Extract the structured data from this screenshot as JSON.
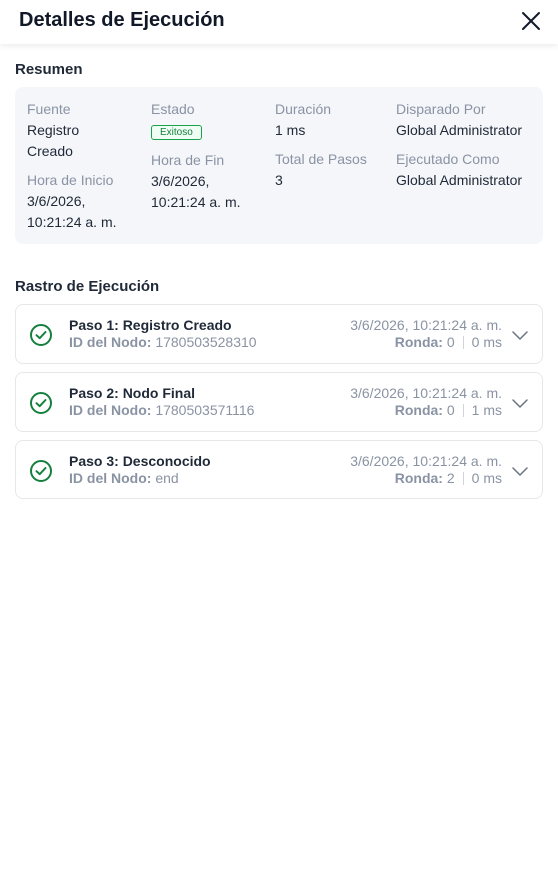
{
  "header": {
    "title": "Detalles de Ejecución"
  },
  "summary": {
    "title": "Resumen",
    "source_label": "Fuente",
    "source_value": "Registro Creado",
    "status_label": "Estado",
    "status_value": "Exitoso",
    "duration_label": "Duración",
    "duration_value": "1 ms",
    "triggered_by_label": "Disparado Por",
    "triggered_by_value": "Global Administrator",
    "start_label": "Hora de Inicio",
    "start_value": "3/6/2026, 10:21:24 a. m.",
    "end_label": "Hora de Fin",
    "end_value": "3/6/2026, 10:21:24 a. m.",
    "total_steps_label": "Total de Pasos",
    "total_steps_value": "3",
    "executed_as_label": "Ejecutado Como",
    "executed_as_value": "Global Administrator"
  },
  "trace": {
    "title": "Rastro de Ejecución",
    "node_label": "ID del Nodo:",
    "round_label": "Ronda:",
    "steps": [
      {
        "title": "Paso 1: Registro Creado",
        "node_id": "1780503528310",
        "time": "3/6/2026, 10:21:24 a. m.",
        "round": "0",
        "duration": "0 ms"
      },
      {
        "title": "Paso 2: Nodo Final",
        "node_id": "1780503571116",
        "time": "3/6/2026, 10:21:24 a. m.",
        "round": "0",
        "duration": "1 ms"
      },
      {
        "title": "Paso 3: Desconocido",
        "node_id": "end",
        "time": "3/6/2026, 10:21:24 a. m.",
        "round": "2",
        "duration": "0 ms"
      }
    ]
  },
  "colors": {
    "success": "#15803d",
    "card_bg": "#f4f6fa",
    "muted": "#8a93a3"
  },
  "icons": {
    "close": "close-icon",
    "step": "check-circle-icon",
    "expand": "chevron-down-icon"
  }
}
